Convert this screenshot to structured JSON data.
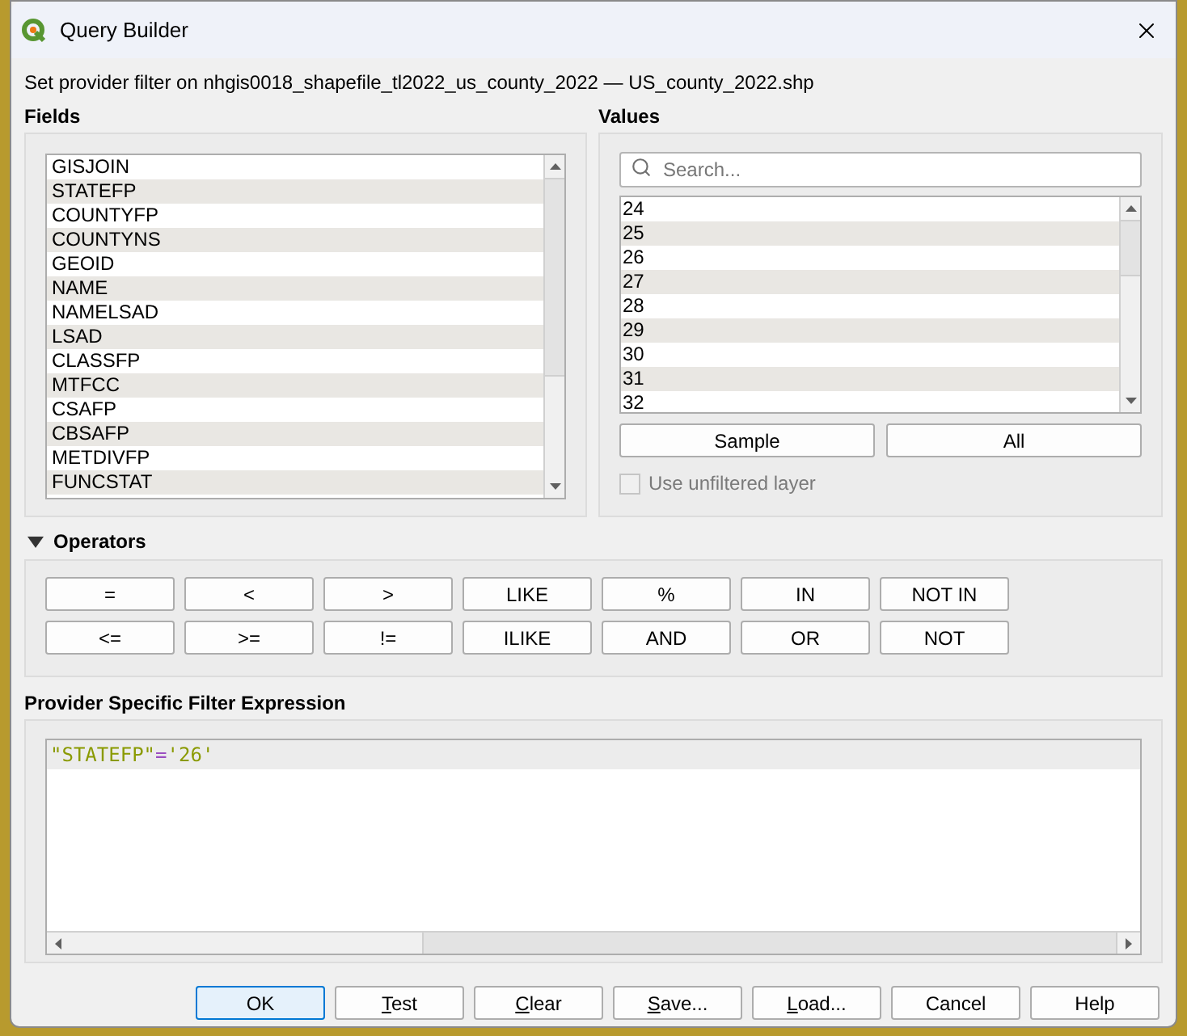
{
  "window": {
    "title": "Query Builder"
  },
  "subtitle": "Set provider filter on nhgis0018_shapefile_tl2022_us_county_2022 — US_county_2022.shp",
  "fields": {
    "label": "Fields",
    "items": [
      "GISJOIN",
      "STATEFP",
      "COUNTYFP",
      "COUNTYNS",
      "GEOID",
      "NAME",
      "NAMELSAD",
      "LSAD",
      "CLASSFP",
      "MTFCC",
      "CSAFP",
      "CBSAFP",
      "METDIVFP",
      "FUNCSTAT"
    ]
  },
  "values": {
    "label": "Values",
    "search": {
      "placeholder": "Search..."
    },
    "items": [
      "24",
      "25",
      "26",
      "27",
      "28",
      "29",
      "30",
      "31",
      "32"
    ],
    "buttons": [
      "Sample",
      "All"
    ],
    "use_unfiltered": {
      "label": "Use unfiltered layer",
      "checked": false,
      "disabled": true
    }
  },
  "operators": {
    "label": "Operators",
    "expanded": true,
    "rows": [
      [
        "=",
        "<",
        ">",
        "LIKE",
        "%",
        "IN",
        "NOT IN"
      ],
      [
        "<=",
        ">=",
        "!=",
        "ILIKE",
        "AND",
        "OR",
        "NOT"
      ]
    ]
  },
  "expression": {
    "label": "Provider Specific Filter Expression",
    "tokens": [
      {
        "text": "\"STATEFP\"",
        "color": "#8a9a00"
      },
      {
        "text": "=",
        "color": "#9b4fc1"
      },
      {
        "text": "'26'",
        "color": "#8a9a00"
      }
    ]
  },
  "buttons": [
    {
      "label": "OK",
      "default": true,
      "mnemonic": false
    },
    {
      "label": "Test",
      "default": false,
      "mnemonic": true
    },
    {
      "label": "Clear",
      "default": false,
      "mnemonic": true
    },
    {
      "label": "Save...",
      "default": false,
      "mnemonic": true
    },
    {
      "label": "Load...",
      "default": false,
      "mnemonic": true
    },
    {
      "label": "Cancel",
      "default": false,
      "mnemonic": false
    },
    {
      "label": "Help",
      "default": false,
      "mnemonic": false
    }
  ]
}
